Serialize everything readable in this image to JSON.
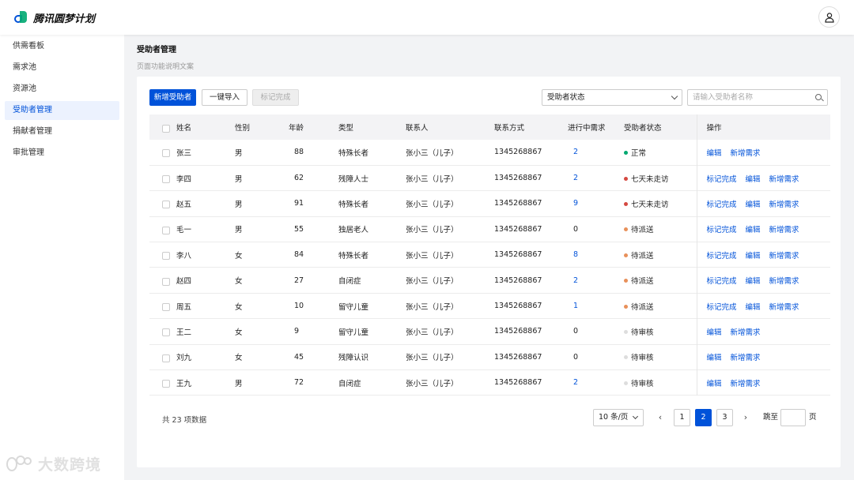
{
  "app": {
    "title": "腾讯圆梦计划"
  },
  "icons": {
    "logo": "app-logo-icon",
    "user": "user-icon",
    "dropdown": "chevron-down-icon",
    "search": "search-icon"
  },
  "colors": {
    "primary": "#0052d9",
    "normal": "#00a870",
    "warning": "#e37318",
    "danger": "#d54941",
    "pending": "#dddddd"
  },
  "sidebar": {
    "items": [
      {
        "label": "供需看板",
        "active": false
      },
      {
        "label": "需求池",
        "active": false
      },
      {
        "label": "资源池",
        "active": false
      },
      {
        "label": "受助者管理",
        "active": true
      },
      {
        "label": "捐献者管理",
        "active": false
      },
      {
        "label": "审批管理",
        "active": false
      }
    ]
  },
  "page": {
    "title": "受助者管理",
    "description": "页面功能说明文案"
  },
  "toolbar": {
    "add_label": "新增受助者",
    "import_label": "一键导入",
    "mark_label": "标记完成",
    "status_select": "受助者状态",
    "search_placeholder": "请输入受助者名称"
  },
  "table": {
    "headers": [
      "姓名",
      "性别",
      "年龄",
      "类型",
      "联系人",
      "联系方式",
      "进行中需求",
      "受助者状态",
      "操作"
    ],
    "rows": [
      {
        "name": "张三",
        "gender": "男",
        "age": "88",
        "type": "特殊长者",
        "contact": "张小三（儿子）",
        "phone": "1345268867",
        "ongoing": "2",
        "status": "正常",
        "status_color": "#00a870",
        "ops": [
          "编辑",
          "新增需求"
        ]
      },
      {
        "name": "李四",
        "gender": "男",
        "age": "62",
        "type": "残障人士",
        "contact": "张小三（儿子）",
        "phone": "1345268867",
        "ongoing": "2",
        "status": "七天未走访",
        "status_color": "#d54941",
        "ops": [
          "标记完成",
          "编辑",
          "新增需求"
        ]
      },
      {
        "name": "赵五",
        "gender": "男",
        "age": "91",
        "type": "特殊长者",
        "contact": "张小三（儿子）",
        "phone": "1345268867",
        "ongoing": "9",
        "status": "七天未走访",
        "status_color": "#d54941",
        "ops": [
          "标记完成",
          "编辑",
          "新增需求"
        ]
      },
      {
        "name": "毛一",
        "gender": "男",
        "age": "55",
        "type": "独居老人",
        "contact": "张小三（儿子）",
        "phone": "1345268867",
        "ongoing": "0",
        "status": "待派送",
        "status_color": "#e8905a",
        "ops": [
          "标记完成",
          "编辑",
          "新增需求"
        ]
      },
      {
        "name": "李八",
        "gender": "女",
        "age": "84",
        "type": "特殊长者",
        "contact": "张小三（儿子）",
        "phone": "1345268867",
        "ongoing": "8",
        "status": "待派送",
        "status_color": "#e8905a",
        "ops": [
          "标记完成",
          "编辑",
          "新增需求"
        ]
      },
      {
        "name": "赵四",
        "gender": "女",
        "age": "27",
        "type": "自闭症",
        "contact": "张小三（儿子）",
        "phone": "1345268867",
        "ongoing": "2",
        "status": "待派送",
        "status_color": "#e8905a",
        "ops": [
          "标记完成",
          "编辑",
          "新增需求"
        ]
      },
      {
        "name": "周五",
        "gender": "女",
        "age": "10",
        "type": "留守儿童",
        "contact": "张小三（儿子）",
        "phone": "1345268867",
        "ongoing": "1",
        "status": "待派送",
        "status_color": "#e8905a",
        "ops": [
          "标记完成",
          "编辑",
          "新增需求"
        ]
      },
      {
        "name": "王二",
        "gender": "女",
        "age": "9",
        "type": "留守儿童",
        "contact": "张小三（儿子）",
        "phone": "1345268867",
        "ongoing": "0",
        "status": "待审核",
        "status_color": "#dddddd",
        "ops": [
          "编辑",
          "新增需求"
        ]
      },
      {
        "name": "刘九",
        "gender": "女",
        "age": "45",
        "type": "残障认识",
        "contact": "张小三（儿子）",
        "phone": "1345268867",
        "ongoing": "0",
        "status": "待审核",
        "status_color": "#dddddd",
        "ops": [
          "编辑",
          "新增需求"
        ]
      },
      {
        "name": "王九",
        "gender": "男",
        "age": "72",
        "type": "自闭症",
        "contact": "张小三（儿子）",
        "phone": "1345268867",
        "ongoing": "2",
        "status": "待审核",
        "status_color": "#dddddd",
        "ops": [
          "编辑",
          "新增需求"
        ]
      }
    ]
  },
  "pagination": {
    "total_text": "共 23 项数据",
    "page_size": "10 条/页",
    "prev": "‹",
    "next": "›",
    "pages": [
      "1",
      "2",
      "3"
    ],
    "current": "2",
    "jump_prefix": "跳至",
    "jump_suffix": "页"
  },
  "watermark": {
    "text": "大数跨境"
  }
}
